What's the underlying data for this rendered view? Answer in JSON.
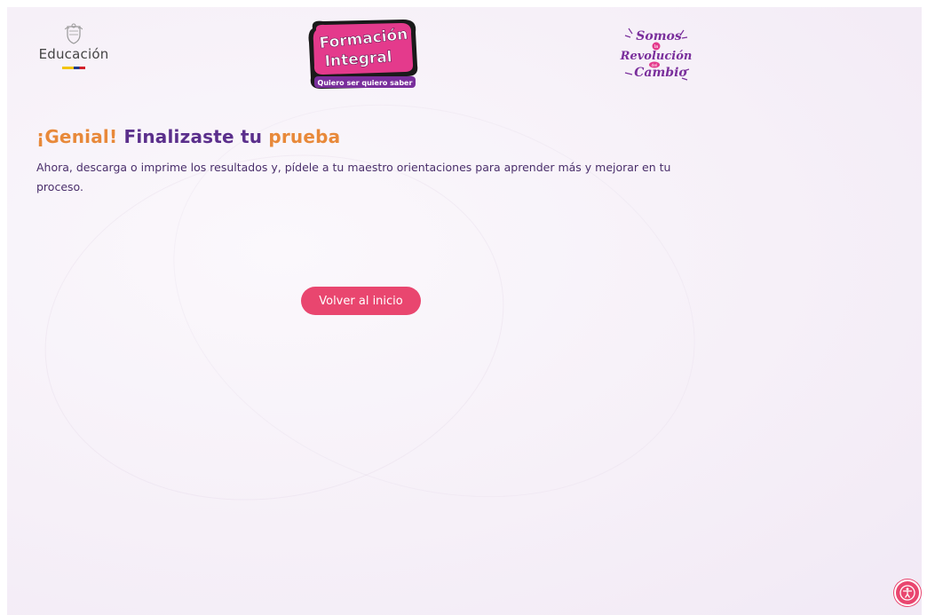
{
  "header": {
    "ministry_logo": {
      "icon": "colombia-crest-icon",
      "label": "Educación"
    },
    "program_logo": {
      "line1": "Formación",
      "line2": "Integral",
      "tagline": "Quiero ser quiero saber"
    },
    "campaign_logo": {
      "line1": "Somos",
      "line2": "la",
      "line3": "Revolución",
      "line4": "del",
      "line5": "Cambio"
    }
  },
  "result": {
    "headline_part1": "¡Genial!",
    "headline_part2": "Finalizaste",
    "headline_part3": "tu",
    "headline_part4": "prueba",
    "message": "Ahora, descarga o imprime los resultados y, pídele a tu maestro orientaciones para aprender más y mejorar en tu proceso."
  },
  "actions": {
    "back_home_label": "Volver al inicio"
  },
  "widgets": {
    "accessibility_icon": "accessibility-icon"
  },
  "colors": {
    "accent_orange": "#e8893a",
    "accent_purple": "#5b2f8c",
    "button_pink": "#e9466f"
  }
}
